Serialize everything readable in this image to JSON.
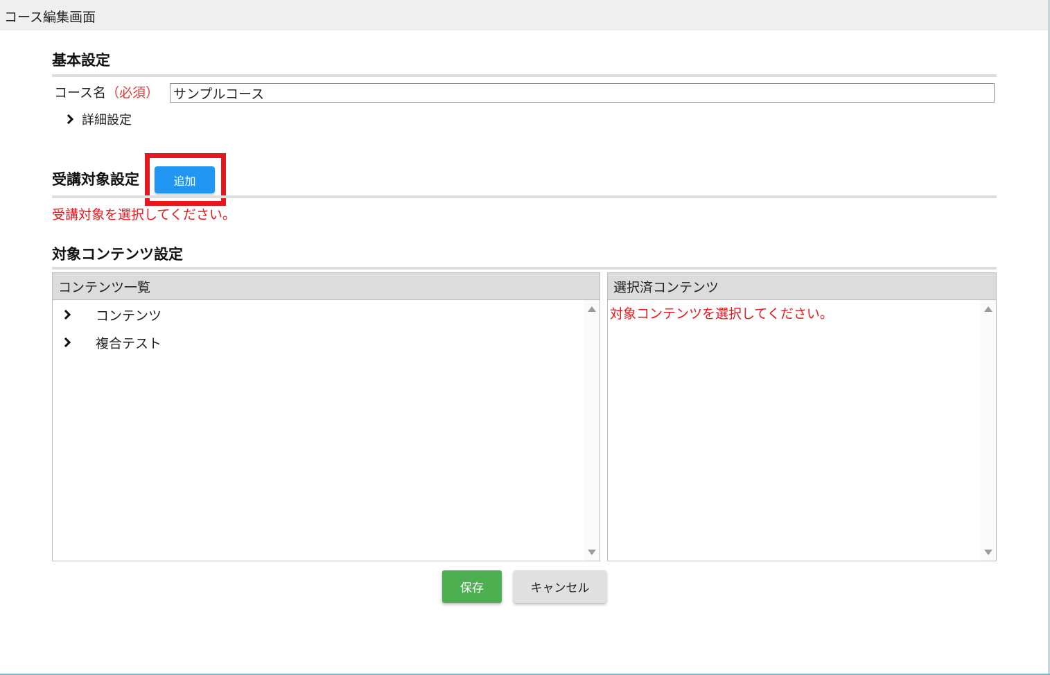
{
  "window": {
    "title": "コース編集画面"
  },
  "basic": {
    "title": "基本設定",
    "course_name_label": "コース名",
    "required_label": "（必須）",
    "course_name_value": "サンプルコース",
    "detail_toggle": "詳細設定"
  },
  "target": {
    "title": "受講対象設定",
    "add_button": "追加",
    "error": "受講対象を選択してください。"
  },
  "content": {
    "title": "対象コンテンツ設定",
    "list_header": "コンテンツ一覧",
    "selected_header": "選択済コンテンツ",
    "items": [
      {
        "label": "コンテンツ"
      },
      {
        "label": "複合テスト"
      }
    ],
    "selected_error": "対象コンテンツを選択してください。"
  },
  "actions": {
    "save": "保存",
    "cancel": "キャンセル"
  },
  "colors": {
    "primary": "#2196f3",
    "success": "#4caf50",
    "error": "#e8161d",
    "highlight": "#e8161d"
  }
}
